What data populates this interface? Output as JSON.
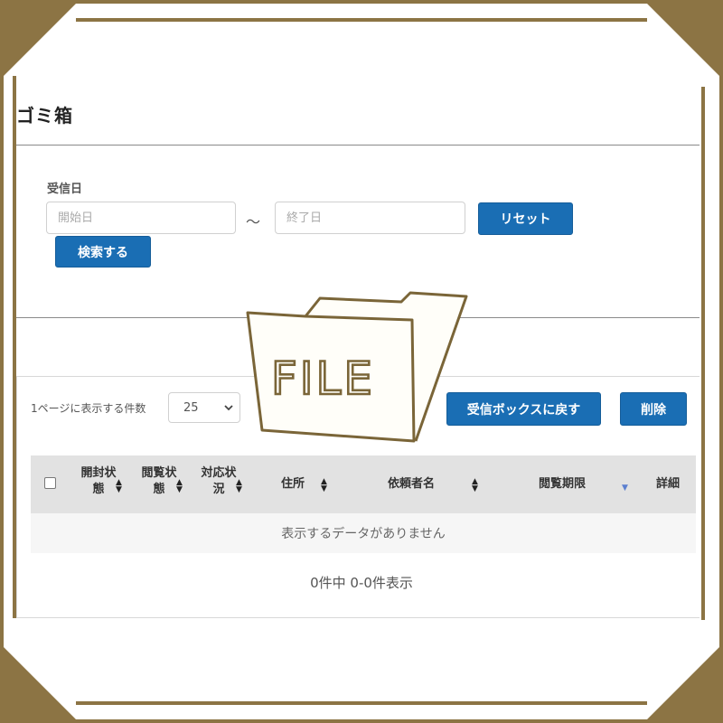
{
  "page": {
    "title": "ゴミ箱"
  },
  "search": {
    "received_date_label": "受信日",
    "start_placeholder": "開始日",
    "end_placeholder": "終了日",
    "tilde": "～",
    "reset_label": "リセット",
    "search_label": "検索する"
  },
  "overlay": {
    "text": "FILE"
  },
  "list": {
    "per_page_label": "1ページに表示する件数",
    "per_page_value": "25",
    "return_inbox_label": "受信ボックスに戻す",
    "delete_label": "削除",
    "columns": {
      "opened_1": "開封状",
      "opened_2": "態",
      "viewed_1": "閲覧状",
      "viewed_2": "態",
      "handled_1": "対応状",
      "handled_2": "況",
      "address": "住所",
      "requester": "依頼者名",
      "view_deadline": "閲覧期限",
      "detail": "詳細"
    },
    "empty_message": "表示するデータがありません",
    "summary": "0件中 0-0件表示"
  },
  "colors": {
    "frame": "#8c7444",
    "primary_button": "#1a6eb4",
    "header_bg": "#e2e2e2"
  }
}
